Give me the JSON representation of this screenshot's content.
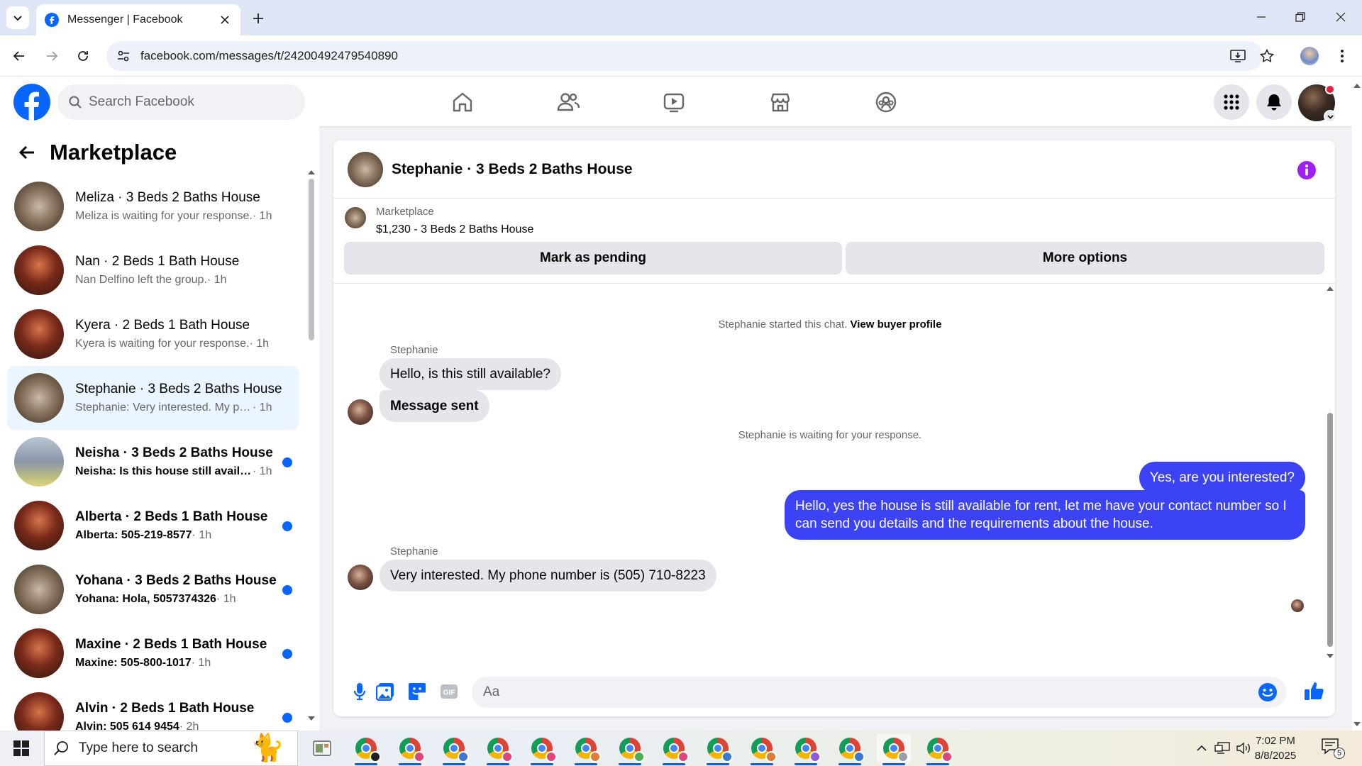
{
  "browser": {
    "tab_title": "Messenger | Facebook",
    "url": "facebook.com/messages/t/24200492479540890"
  },
  "fb": {
    "search_placeholder": "Search Facebook"
  },
  "sidebar": {
    "title": "Marketplace",
    "conversations": [
      {
        "name": "Meliza · 3 Beds 2 Baths House",
        "snippet": "Meliza is waiting for your response.",
        "time": " · 1h",
        "unread": false,
        "avatar": "house-interior"
      },
      {
        "name": "Nan · 2 Beds 1 Bath House",
        "snippet": "Nan Delfino left the group.",
        "time": " · 1h",
        "unread": false,
        "avatar": "house-exterior"
      },
      {
        "name": "Kyera · 2 Beds 1 Bath House",
        "snippet": "Kyera is waiting for your response.",
        "time": " · 1h",
        "unread": false,
        "avatar": "house-exterior"
      },
      {
        "name": "Stephanie · 3 Beds 2 Baths House",
        "snippet": "Stephanie: Very interested. My pho...",
        "time": " · 1h",
        "unread": false,
        "active": true,
        "avatar": "house-interior"
      },
      {
        "name": "Neisha · 3 Beds 2 Baths House",
        "snippet": "Neisha: Is this house still availab...",
        "time": " · 1h",
        "unread": true,
        "avatar": "house-street"
      },
      {
        "name": "Alberta · 2 Beds 1 Bath House",
        "snippet": "Alberta: 505-219-8577",
        "time": " · 1h",
        "unread": true,
        "avatar": "house-exterior"
      },
      {
        "name": "Yohana · 3 Beds 2 Baths House",
        "snippet": "Yohana: Hola, 5057374326",
        "time": " · 1h",
        "unread": true,
        "avatar": "house-interior"
      },
      {
        "name": "Maxine · 2 Beds 1 Bath House",
        "snippet": "Maxine: 505-800-1017",
        "time": " · 1h",
        "unread": true,
        "avatar": "house-exterior"
      },
      {
        "name": "Alvin · 2 Beds 1 Bath House",
        "snippet": "Alvin: 505 614 9454",
        "time": " · 2h",
        "unread": true,
        "avatar": "house-exterior"
      }
    ]
  },
  "chat": {
    "header_title": "Stephanie · 3 Beds 2 Baths House",
    "listing_category": "Marketplace",
    "listing_title": "$1,230 - 3 Beds 2 Baths House",
    "mark_pending_label": "Mark as pending",
    "more_options_label": "More options",
    "started_text": "Stephanie started this chat.",
    "view_profile_label": "View buyer profile",
    "sender_1": "Stephanie",
    "msg_in_1": "Hello, is this still available?",
    "msg_in_2": "Message sent",
    "waiting_text": "Stephanie is waiting for your response.",
    "msg_out_1": "Yes, are you interested?",
    "msg_out_2": "Hello, yes the house is still available for rent, let me have your contact number so I can send you details and the requirements about the house.",
    "sender_2": "Stephanie",
    "msg_in_3": "Very interested. My phone number is (505) 710-8223",
    "composer_placeholder": "Aa"
  },
  "taskbar": {
    "search_placeholder": "Type here to search",
    "time": "7:02 PM",
    "date": "8/8/2025",
    "notification_count": "5",
    "profile_badge_colors": [
      "#202124",
      "#e0457b",
      "#3a78d6",
      "#e0457b",
      "#e0457b",
      "#e07b3a",
      "#4caf50",
      "#e0457b",
      "#3a78d6",
      "#e07b3a",
      "#8e5bd6",
      "#3a78d6",
      "#9aa0a6",
      "#e0457b"
    ]
  },
  "colors": {
    "fb_blue": "#0866ff",
    "outgoing_bubble": "#3b43f5",
    "info_purple": "#a020f0"
  }
}
